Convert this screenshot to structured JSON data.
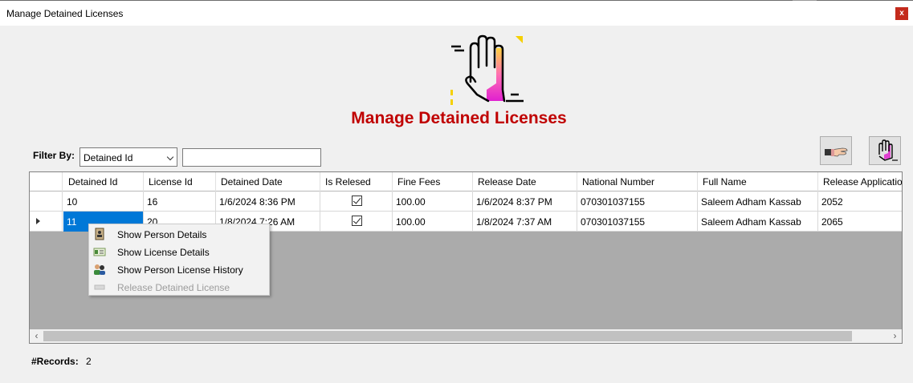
{
  "window": {
    "title": "Manage Detained Licenses",
    "close_label": "x"
  },
  "header": {
    "title": "Manage Detained Licenses"
  },
  "filter": {
    "label": "Filter By:",
    "selected": "Detained Id",
    "search_value": ""
  },
  "grid": {
    "columns": [
      "Detained Id",
      "License Id",
      "Detained Date",
      "Is Relesed",
      "Fine Fees",
      "Release Date",
      "National Number",
      "Full Name",
      "Release Applicatio"
    ],
    "rows": [
      {
        "detained_id": "10",
        "license_id": "16",
        "detained_date": "1/6/2024 8:36 PM",
        "is_released": true,
        "fine_fees": "100.00",
        "release_date": "1/6/2024 8:37 PM",
        "national_number": "070301037155",
        "full_name": "Saleem Adham Kassab",
        "release_app": "2052"
      },
      {
        "detained_id": "11",
        "license_id": "20",
        "detained_date": "1/8/2024 7:26 AM",
        "is_released": true,
        "fine_fees": "100.00",
        "release_date": "1/8/2024 7:37 AM",
        "national_number": "070301037155",
        "full_name": "Saleem Adham Kassab",
        "release_app": "2065"
      }
    ]
  },
  "context_menu": {
    "items": [
      {
        "label": "Show Person Details",
        "icon": "person-card-icon",
        "enabled": true
      },
      {
        "label": "Show License Details",
        "icon": "license-icon",
        "enabled": true
      },
      {
        "label": "Show Person License History",
        "icon": "people-icon",
        "enabled": true
      },
      {
        "label": "Release Detained License",
        "icon": "release-icon",
        "enabled": false
      }
    ]
  },
  "footer": {
    "records_label": "#Records:",
    "records_count": "2"
  },
  "colors": {
    "title_red": "#c00000",
    "selection_blue": "#0078d7",
    "close_red": "#c42b1c"
  }
}
